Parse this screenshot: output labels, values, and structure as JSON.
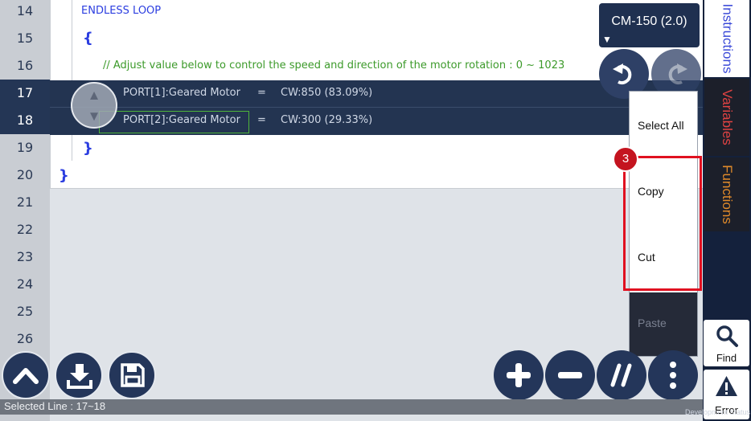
{
  "line_numbers": [
    "14",
    "15",
    "16",
    "17",
    "18",
    "19",
    "20",
    "21",
    "22",
    "23",
    "24",
    "25",
    "26"
  ],
  "code": {
    "line14": "ENDLESS LOOP",
    "line15": "{",
    "line16_comment": "//    Adjust value below to control the speed and direction of the motor rotation  : 0 ~ 1023",
    "line17_port": "PORT[1]:Geared Motor",
    "line17_eq": "=",
    "line17_value": "CW:850 (83.09%)",
    "line18_port": "PORT[2]:Geared Motor",
    "line18_eq": "=",
    "line18_value": "CW:300 (29.33%)",
    "line19": "}",
    "line20": "}"
  },
  "device": {
    "label": "CM-150 (2.0)"
  },
  "side_tabs": {
    "instructions": "Instructions",
    "variables": "Variables",
    "functions": "Functions"
  },
  "tools": {
    "find": "Find",
    "error": "Error"
  },
  "context_menu": {
    "select_all": "Select All",
    "copy": "Copy",
    "cut": "Cut",
    "paste": "Paste"
  },
  "step_badge": "3",
  "status": {
    "selected": "Selected Line : 17~18"
  },
  "dev_label": "Development Status",
  "colors": {
    "navy": "#24365a",
    "selection": "#233451",
    "highlight_red": "#e01020",
    "keyword_blue": "#2b3de0",
    "comment_green": "#3c9a2a"
  },
  "icons": [
    "up-arrow-icon",
    "down-arrow-icon",
    "undo-icon",
    "redo-icon",
    "chevron-up-icon",
    "download-icon",
    "save-icon",
    "plus-icon",
    "minus-icon",
    "comment-slash-icon",
    "more-vertical-icon",
    "search-icon",
    "warning-icon"
  ]
}
